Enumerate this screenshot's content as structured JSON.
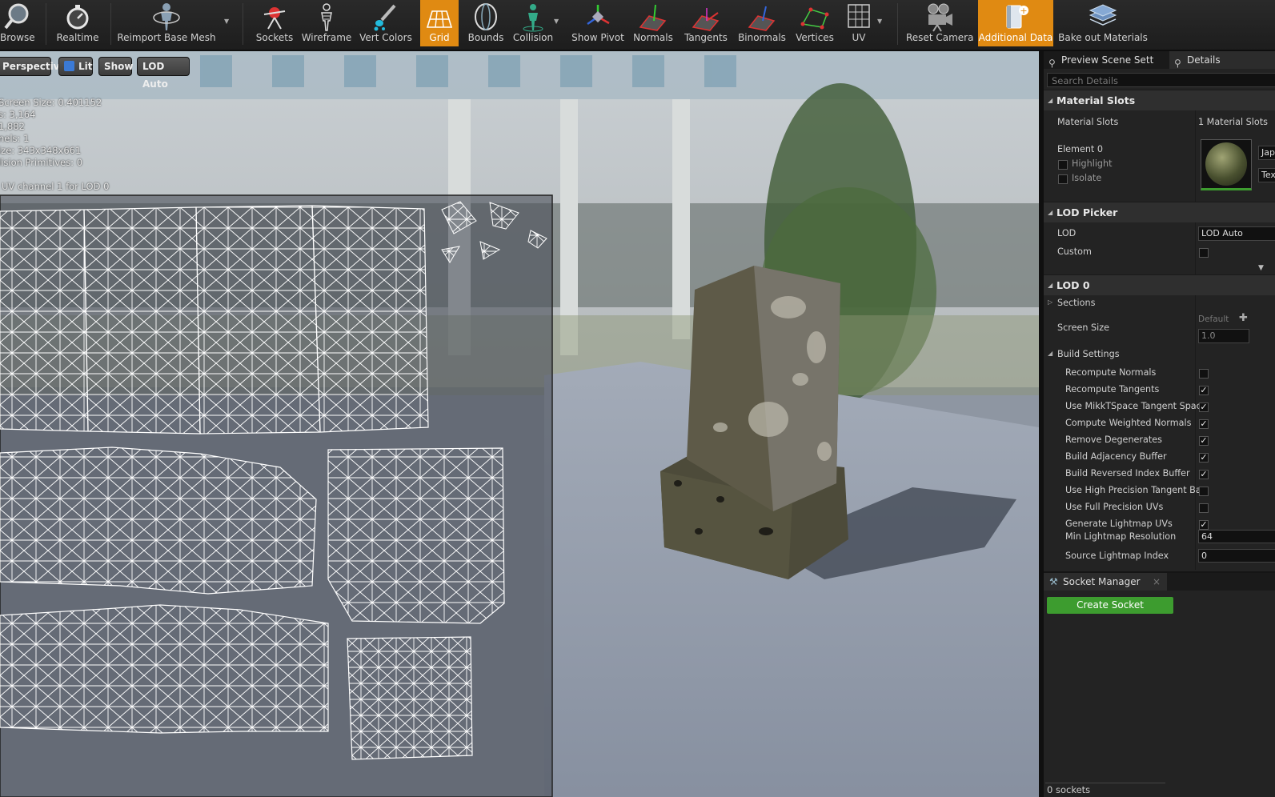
{
  "toolbar": {
    "items": [
      {
        "label": "Browse",
        "icon": "magnifier-icon"
      },
      {
        "label": "Realtime",
        "icon": "stopwatch-icon"
      },
      {
        "label": "Reimport Base Mesh",
        "icon": "mannequin-icon"
      },
      {
        "label": "Sockets",
        "icon": "socket-icon"
      },
      {
        "label": "Wireframe",
        "icon": "wireframe-figure-icon"
      },
      {
        "label": "Vert Colors",
        "icon": "paint-brush-icon"
      },
      {
        "label": "Grid",
        "icon": "grid-icon",
        "active": true
      },
      {
        "label": "Bounds",
        "icon": "bounds-icon"
      },
      {
        "label": "Collision",
        "icon": "collision-icon"
      },
      {
        "label": "Show Pivot",
        "icon": "pivot-icon"
      },
      {
        "label": "Normals",
        "icon": "normals-icon"
      },
      {
        "label": "Tangents",
        "icon": "tangents-icon"
      },
      {
        "label": "Binormals",
        "icon": "binormals-icon"
      },
      {
        "label": "Vertices",
        "icon": "vertices-icon"
      },
      {
        "label": "UV",
        "icon": "uv-grid-icon"
      },
      {
        "label": "Reset Camera",
        "icon": "camera-icon"
      },
      {
        "label": "Additional Data",
        "icon": "additional-data-icon",
        "active": true
      },
      {
        "label": "Bake out Materials",
        "icon": "layers-icon"
      }
    ]
  },
  "viewport": {
    "buttons": {
      "perspective": "Perspective",
      "lit": "Lit",
      "show": "Show",
      "lod": "LOD Auto"
    },
    "stats": [
      "Screen Size:  0.401152",
      "s:  3,164",
      "  1,882",
      "nels:  1",
      "ize:  343x348x661",
      "lision Primitives:  0"
    ],
    "uv_label": "UV channel 1 for LOD 0"
  },
  "details": {
    "tabs": [
      "Preview Scene Sett",
      "Details"
    ],
    "search_placeholder": "Search Details",
    "material_slots": {
      "header": "Material Slots",
      "label": "Material Slots",
      "value": "1 Material Slots",
      "element": "Element 0",
      "highlight": "Highlight",
      "isolate": "Isolate",
      "material_name": "Jap",
      "texture_name": "Tex"
    },
    "lod_picker": {
      "header": "LOD Picker",
      "lod_label": "LOD",
      "lod_value": "LOD Auto",
      "custom_label": "Custom"
    },
    "lod0": {
      "header": "LOD 0",
      "sections": "Sections",
      "screen_size_label": "Screen Size",
      "screen_size_default": "Default",
      "screen_size_value": "1.0",
      "build_settings": "Build Settings",
      "settings": [
        {
          "label": "Recompute Normals",
          "checked": false
        },
        {
          "label": "Recompute Tangents",
          "checked": true
        },
        {
          "label": "Use MikkTSpace Tangent Spac",
          "checked": true
        },
        {
          "label": "Compute Weighted Normals",
          "checked": true
        },
        {
          "label": "Remove Degenerates",
          "checked": true
        },
        {
          "label": "Build Adjacency Buffer",
          "checked": true
        },
        {
          "label": "Build Reversed Index Buffer",
          "checked": true
        },
        {
          "label": "Use High Precision Tangent Bas",
          "checked": false
        },
        {
          "label": "Use Full Precision UVs",
          "checked": false
        },
        {
          "label": "Generate Lightmap UVs",
          "checked": true
        }
      ],
      "min_lightmap_label": "Min Lightmap Resolution",
      "min_lightmap_value": "64",
      "source_lightmap_label": "Source Lightmap Index",
      "source_lightmap_value": "0"
    }
  },
  "socket_manager": {
    "title": "Socket Manager",
    "close": "×",
    "create_button": "Create Socket",
    "count": "0 sockets"
  },
  "colors": {
    "accent": "#e08a12",
    "green_button": "#3d9c2f",
    "panel": "#232323"
  }
}
